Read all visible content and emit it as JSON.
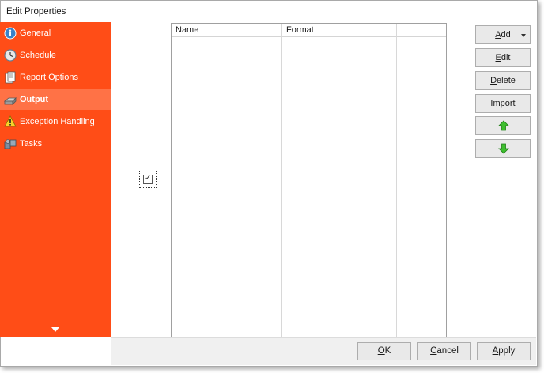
{
  "window": {
    "title": "Edit Properties"
  },
  "sidebar": {
    "items": [
      {
        "label": "General",
        "icon": "info-icon",
        "active": false
      },
      {
        "label": "Schedule",
        "icon": "clock-icon",
        "active": false
      },
      {
        "label": "Report Options",
        "icon": "document-icon",
        "active": false
      },
      {
        "label": "Output",
        "icon": "printer-icon",
        "active": true
      },
      {
        "label": "Exception Handling",
        "icon": "warning-icon",
        "active": false
      },
      {
        "label": "Tasks",
        "icon": "tasks-icon",
        "active": false
      }
    ]
  },
  "list": {
    "columns": [
      "Name",
      "Format",
      ""
    ],
    "rows": []
  },
  "checkbox": {
    "checked": true
  },
  "buttons": {
    "add": {
      "prefix": "",
      "accel": "A",
      "rest": "dd"
    },
    "edit": {
      "prefix": "",
      "accel": "E",
      "rest": "dit"
    },
    "delete": {
      "prefix": "",
      "accel": "D",
      "rest": "elete"
    },
    "import": {
      "label": "Import"
    }
  },
  "footer": {
    "ok": {
      "accel": "O",
      "rest": "K"
    },
    "cancel": {
      "accel": "C",
      "rest": "ancel"
    },
    "apply": {
      "accel": "A",
      "rest": "pply"
    }
  },
  "colors": {
    "sidebar": "#ff4d17",
    "sidebar_active": "#ff7246",
    "arrow": "#3fbf2f"
  }
}
